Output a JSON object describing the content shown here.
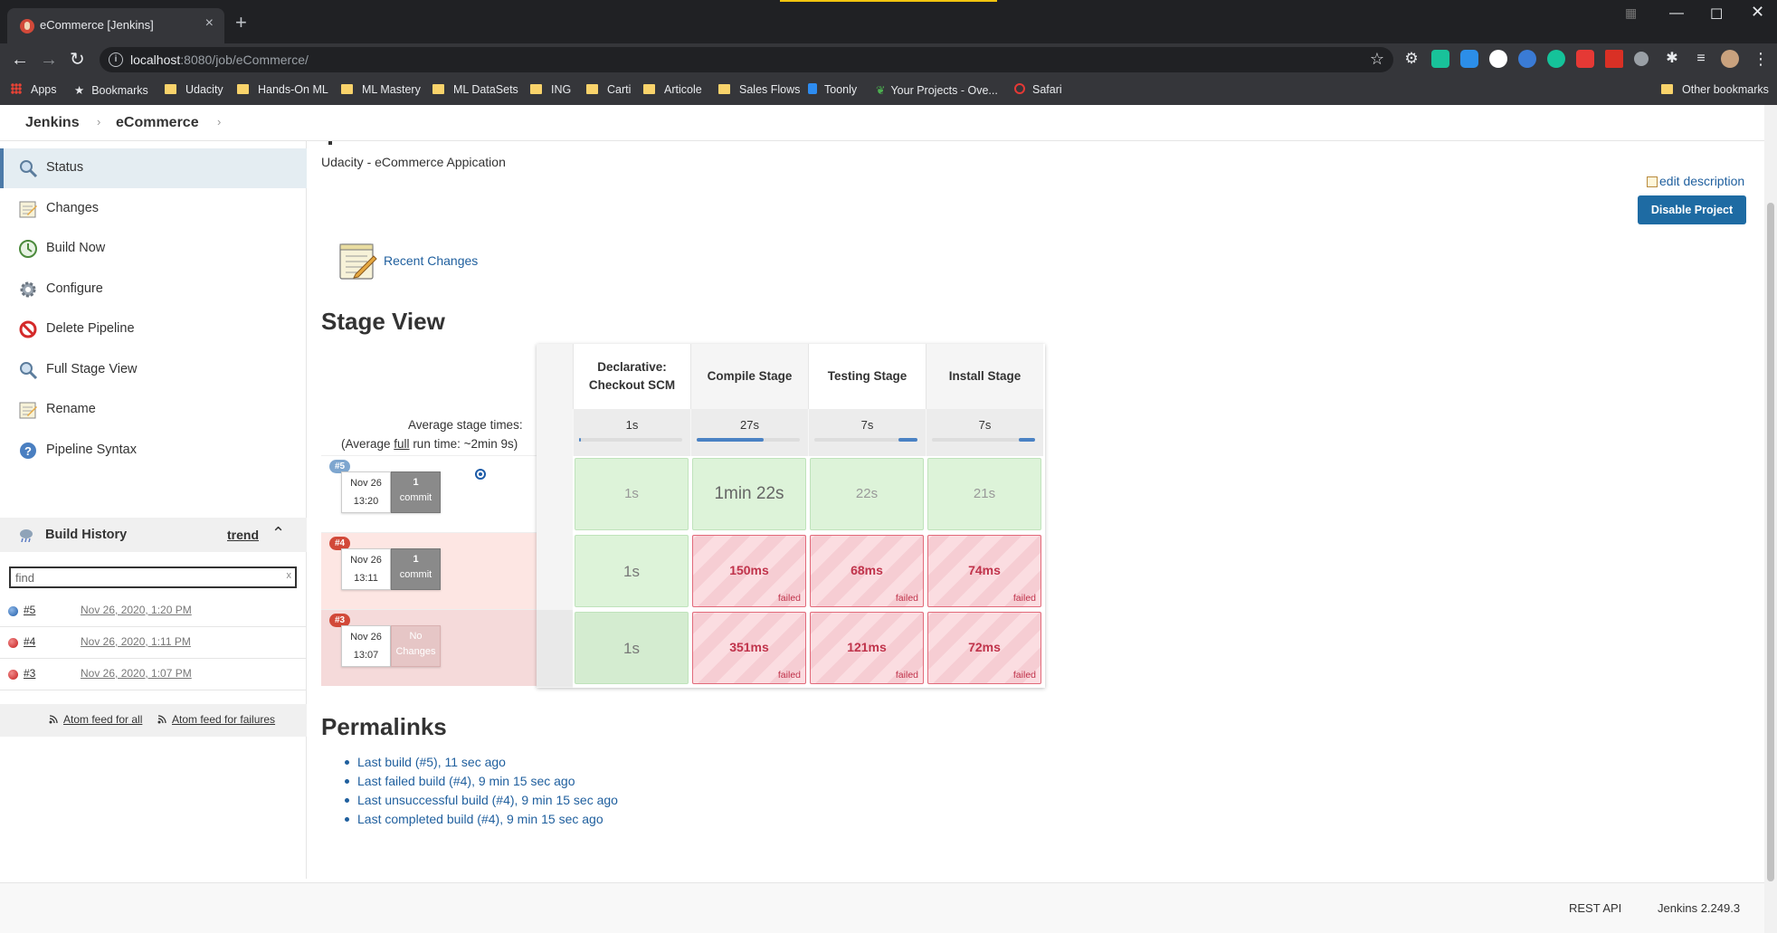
{
  "browser": {
    "tab_title": "eCommerce [Jenkins]",
    "url_host": "localhost",
    "url_rest": ":8080/job/eCommerce/",
    "bookmarks": [
      {
        "label": "Apps",
        "icon": "apps-grid-icon"
      },
      {
        "label": "Bookmarks",
        "icon": "star-icon"
      },
      {
        "label": "Udacity",
        "icon": "folder-icon"
      },
      {
        "label": "Hands-On ML",
        "icon": "folder-icon"
      },
      {
        "label": "ML Mastery",
        "icon": "folder-icon"
      },
      {
        "label": "ML DataSets",
        "icon": "folder-icon"
      },
      {
        "label": "ING",
        "icon": "folder-icon"
      },
      {
        "label": "Carti",
        "icon": "folder-icon"
      },
      {
        "label": "Articole",
        "icon": "folder-icon"
      },
      {
        "label": "Sales Flows",
        "icon": "folder-icon"
      },
      {
        "label": "Toonly",
        "icon": "toonly-icon"
      },
      {
        "label": "Your Projects - Ove...",
        "icon": "leaf-icon"
      },
      {
        "label": "Safari",
        "icon": "safari-icon"
      }
    ],
    "other_bookmarks": "Other bookmarks"
  },
  "breadcrumb": [
    "Jenkins",
    "eCommerce"
  ],
  "sidebar": {
    "tasks": [
      {
        "label": "Status",
        "icon": "magnifier-icon",
        "active": true
      },
      {
        "label": "Changes",
        "icon": "notepad-icon"
      },
      {
        "label": "Build Now",
        "icon": "build-clock-icon"
      },
      {
        "label": "Configure",
        "icon": "gear-icon"
      },
      {
        "label": "Delete Pipeline",
        "icon": "no-entry-icon"
      },
      {
        "label": "Full Stage View",
        "icon": "magnifier-icon"
      },
      {
        "label": "Rename",
        "icon": "notepad-icon"
      },
      {
        "label": "Pipeline Syntax",
        "icon": "help-icon"
      }
    ],
    "build_history": {
      "title": "Build History",
      "trend": "trend",
      "search_value": "find",
      "search_clear": "x",
      "builds": [
        {
          "number": "#5",
          "date": "Nov 26, 2020, 1:20 PM",
          "status": "success"
        },
        {
          "number": "#4",
          "date": "Nov 26, 2020, 1:11 PM",
          "status": "failed"
        },
        {
          "number": "#3",
          "date": "Nov 26, 2020, 1:07 PM",
          "status": "failed"
        }
      ],
      "feed_all": "Atom feed for all",
      "feed_failures": "Atom feed for failures"
    }
  },
  "main": {
    "description": "Udacity - eCommerce Appication",
    "edit_description": "edit description",
    "disable_button": "Disable Project",
    "recent_changes": "Recent Changes",
    "stage_view_title": "Stage View",
    "avg_label_1": "Average stage times:",
    "avg_label_2_pre": "(Average ",
    "avg_label_2_full": "full",
    "avg_label_2_post": " run time: ~2min 9s)",
    "stages": [
      {
        "name": "Declarative: Checkout SCM",
        "avg": "1s",
        "bar_fill": 0.0
      },
      {
        "name": "Compile Stage",
        "avg": "27s",
        "bar_fill": 0.65
      },
      {
        "name": "Testing Stage",
        "avg": "7s",
        "bar_fill": 0.18
      },
      {
        "name": "Install Stage",
        "avg": "7s",
        "bar_fill": 0.16
      }
    ],
    "builds": [
      {
        "badge": "#5",
        "date": "Nov 26",
        "time": "13:20",
        "changes_line1": "1",
        "changes_line2": "commit",
        "cells": [
          {
            "value": "1s",
            "status": "success"
          },
          {
            "value": "1min 22s",
            "status": "success"
          },
          {
            "value": "22s",
            "status": "success"
          },
          {
            "value": "21s",
            "status": "success"
          }
        ]
      },
      {
        "badge": "#4",
        "date": "Nov 26",
        "time": "13:11",
        "changes_line1": "1",
        "changes_line2": "commit",
        "cells": [
          {
            "value": "1s",
            "status": "success"
          },
          {
            "value": "150ms",
            "status": "failed"
          },
          {
            "value": "68ms",
            "status": "failed"
          },
          {
            "value": "74ms",
            "status": "failed"
          }
        ]
      },
      {
        "badge": "#3",
        "date": "Nov 26",
        "time": "13:07",
        "changes_line1": "No",
        "changes_line2": "Changes",
        "cells": [
          {
            "value": "1s",
            "status": "success"
          },
          {
            "value": "351ms",
            "status": "failed"
          },
          {
            "value": "121ms",
            "status": "failed"
          },
          {
            "value": "72ms",
            "status": "failed"
          }
        ]
      }
    ],
    "failed_label": "failed",
    "permalinks_title": "Permalinks",
    "permalinks": [
      "Last build (#5), 11 sec ago",
      "Last failed build (#4), 9 min 15 sec ago",
      "Last unsuccessful build (#4), 9 min 15 sec ago",
      "Last completed build (#4), 9 min 15 sec ago"
    ]
  },
  "footer": {
    "rest_api": "REST API",
    "version": "Jenkins 2.249.3"
  },
  "colors": {
    "jenkins_blue": "#1e6ba3",
    "link": "#1f5f9e",
    "success_cell": "#ddf3d9",
    "failed_cell": "#fbdde1",
    "failed_text": "#c0334b",
    "badge_success": "#7ea6cf",
    "badge_failed": "#d24939"
  }
}
